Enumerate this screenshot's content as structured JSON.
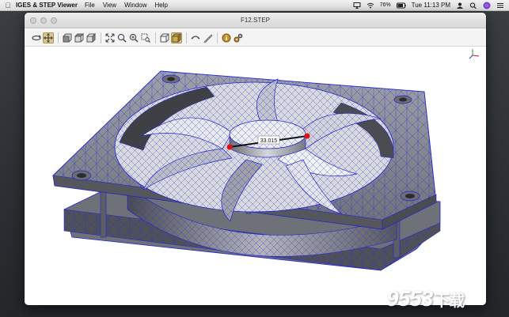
{
  "menubar": {
    "app_name": "IGES & STEP Viewer",
    "menus": [
      "File",
      "View",
      "Window",
      "Help"
    ],
    "battery": "76%",
    "clock": "Tue 11:13 PM"
  },
  "window": {
    "title": "F12.STEP"
  },
  "toolbar": {
    "buttons": [
      {
        "icon": "rotate-icon"
      },
      {
        "icon": "pan-icon",
        "active": true
      },
      {
        "icon": "view-front-icon"
      },
      {
        "icon": "view-top-icon"
      },
      {
        "icon": "view-side-icon"
      },
      {
        "icon": "fit-all-icon"
      },
      {
        "icon": "zoom-icon"
      },
      {
        "icon": "zoom-in-icon"
      },
      {
        "icon": "zoom-window-icon"
      },
      {
        "icon": "wireframe-icon"
      },
      {
        "icon": "shaded-icon",
        "active": true
      },
      {
        "icon": "measure-icon"
      },
      {
        "icon": "ruler-icon"
      },
      {
        "icon": "info-icon"
      },
      {
        "icon": "settings-icon"
      }
    ]
  },
  "measurement": {
    "value": "33.015"
  },
  "colors": {
    "mesh": "#1e22d6",
    "surface": "#8a8c93",
    "marker": "#e01010",
    "active_button": "#d8c68b"
  },
  "watermark": {
    "text": "9553",
    "cn": "下载"
  }
}
